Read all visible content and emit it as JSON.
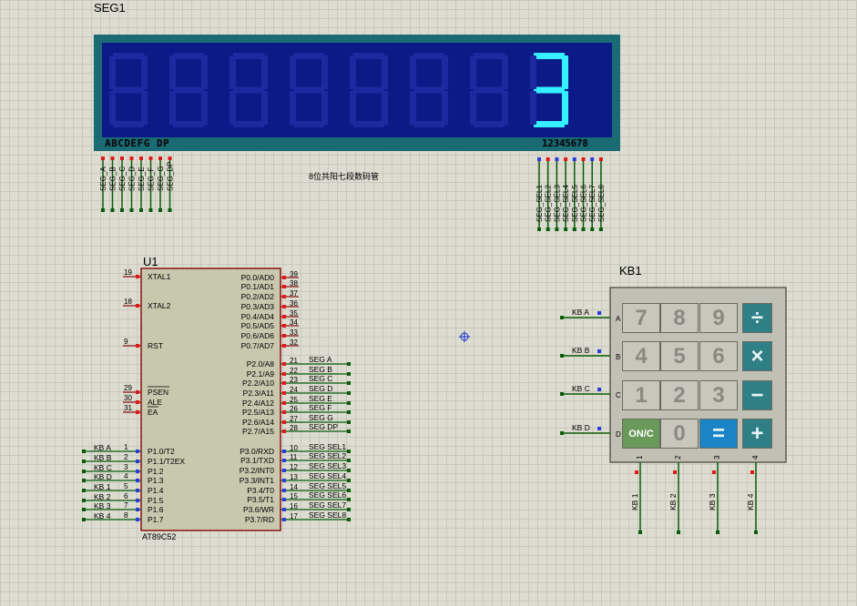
{
  "seg": {
    "ref": "SEG1",
    "segment_labels": "ABCDEFG DP",
    "digit_labels": "12345678",
    "displayed_digit": "3",
    "caption": "8位共阳七段数码管",
    "seg_nets": [
      "SEG_A",
      "SEG_B",
      "SEG_C",
      "SEG_D",
      "SEG_E",
      "SEG_F",
      "SEG_G",
      "SEG_DP"
    ],
    "sel_nets": [
      "SEG_SEL1",
      "SEG_SEL2",
      "SEG_SEL3",
      "SEG_SEL4",
      "SEG_SEL5",
      "SEG_SEL6",
      "SEG_SEL7",
      "SEG_SEL8"
    ]
  },
  "mcu": {
    "ref": "U1",
    "part": "AT89C52",
    "left_pins": [
      {
        "num": "19",
        "name": "XTAL1"
      },
      {
        "num": "18",
        "name": "XTAL2"
      },
      {
        "num": "9",
        "name": "RST"
      },
      {
        "num": "29",
        "name": "PSEN"
      },
      {
        "num": "30",
        "name": "ALE"
      },
      {
        "num": "31",
        "name": "EA"
      },
      {
        "num": "1",
        "name": "P1.0/T2",
        "net": "KB_A"
      },
      {
        "num": "2",
        "name": "P1.1/T2EX",
        "net": "KB_B"
      },
      {
        "num": "3",
        "name": "P1.2",
        "net": "KB_C"
      },
      {
        "num": "4",
        "name": "P1.3",
        "net": "KB_D"
      },
      {
        "num": "5",
        "name": "P1.4",
        "net": "KB_1"
      },
      {
        "num": "6",
        "name": "P1.5",
        "net": "KB_2"
      },
      {
        "num": "7",
        "name": "P1.6",
        "net": "KB_3"
      },
      {
        "num": "8",
        "name": "P1.7",
        "net": "KB_4"
      }
    ],
    "right_pins_p0": [
      {
        "num": "39",
        "name": "P0.0/AD0"
      },
      {
        "num": "38",
        "name": "P0.1/AD1"
      },
      {
        "num": "37",
        "name": "P0.2/AD2"
      },
      {
        "num": "36",
        "name": "P0.3/AD3"
      },
      {
        "num": "35",
        "name": "P0.4/AD4"
      },
      {
        "num": "34",
        "name": "P0.5/AD5"
      },
      {
        "num": "33",
        "name": "P0.6/AD6"
      },
      {
        "num": "32",
        "name": "P0.7/AD7"
      }
    ],
    "right_pins_p2": [
      {
        "num": "21",
        "name": "P2.0/A8",
        "net": "SEG_A"
      },
      {
        "num": "22",
        "name": "P2.1/A9",
        "net": "SEG_B"
      },
      {
        "num": "23",
        "name": "P2.2/A10",
        "net": "SEG_C"
      },
      {
        "num": "24",
        "name": "P2.3/A11",
        "net": "SEG_D"
      },
      {
        "num": "25",
        "name": "P2.4/A12",
        "net": "SEG_E"
      },
      {
        "num": "26",
        "name": "P2.5/A13",
        "net": "SEG_F"
      },
      {
        "num": "27",
        "name": "P2.6/A14",
        "net": "SEG_G"
      },
      {
        "num": "28",
        "name": "P2.7/A15",
        "net": "SEG_DP"
      }
    ],
    "right_pins_p3": [
      {
        "num": "10",
        "name": "P3.0/RXD",
        "net": "SEG_SEL1"
      },
      {
        "num": "11",
        "name": "P3.1/TXD",
        "net": "SEG_SEL2"
      },
      {
        "num": "12",
        "name": "P3.2/INT0",
        "net": "SEG_SEL3"
      },
      {
        "num": "13",
        "name": "P3.3/INT1",
        "net": "SEG_SEL4"
      },
      {
        "num": "14",
        "name": "P3.4/T0",
        "net": "SEG_SEL5"
      },
      {
        "num": "15",
        "name": "P3.5/T1",
        "net": "SEG_SEL6"
      },
      {
        "num": "16",
        "name": "P3.6/WR",
        "net": "SEG_SEL7"
      },
      {
        "num": "17",
        "name": "P3.7/RD",
        "net": "SEG_SEL8"
      }
    ]
  },
  "keypad": {
    "ref": "KB1",
    "row_labels": [
      "A",
      "B",
      "C",
      "D"
    ],
    "col_labels": [
      "1",
      "2",
      "3",
      "4"
    ],
    "row_nets": [
      "KB_A",
      "KB_B",
      "KB_C",
      "KB_D"
    ],
    "col_nets": [
      "KB_1",
      "KB_2",
      "KB_3",
      "KB_4"
    ],
    "keys": [
      [
        "7",
        "8",
        "9",
        "÷"
      ],
      [
        "4",
        "5",
        "6",
        "×"
      ],
      [
        "1",
        "2",
        "3",
        "−"
      ],
      [
        "ON/C",
        "0",
        "=",
        "+"
      ]
    ]
  },
  "colors": {
    "lcd_frame": "#1b6b75",
    "lcd_bg": "#0c1a87",
    "lcd_dim_segment": "#1c2aa0",
    "lcd_lit_segment": "#35f0ff",
    "ic_body": "#c8c8ae",
    "ic_border": "#8a1414",
    "wire": "#0a5c0a",
    "pin_red": "#e01818",
    "pin_blue": "#2d3bdc"
  }
}
